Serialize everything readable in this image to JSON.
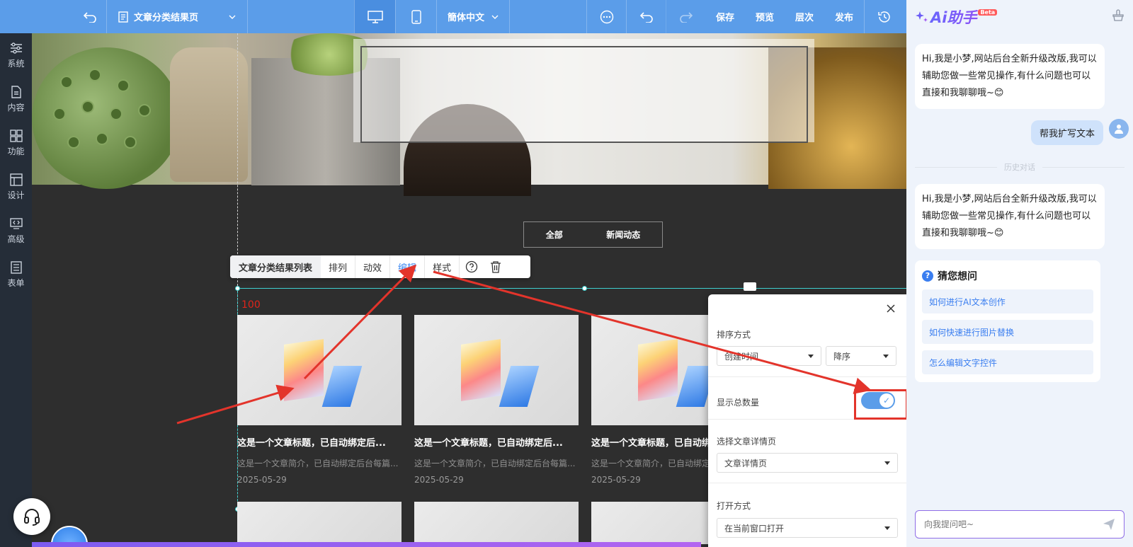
{
  "toolbar": {
    "page_name": "文章分类结果页",
    "language": "簡体中文",
    "save": "保存",
    "preview": "预览",
    "layers": "层次",
    "publish": "发布"
  },
  "sidebar": {
    "items": [
      {
        "label": "系统",
        "icon": "sliders-icon"
      },
      {
        "label": "内容",
        "icon": "document-icon"
      },
      {
        "label": "功能",
        "icon": "grid-icon"
      },
      {
        "label": "设计",
        "icon": "layout-icon"
      },
      {
        "label": "高级",
        "icon": "code-icon"
      },
      {
        "label": "表单",
        "icon": "form-icon"
      }
    ]
  },
  "canvas": {
    "category_tabs": [
      "全部",
      "新闻动态"
    ],
    "context_toolbar": {
      "title": "文章分类结果列表",
      "items": [
        "排列",
        "动效",
        "编辑",
        "样式"
      ]
    },
    "total_count": "100",
    "cards": [
      {
        "title": "这是一个文章标题，已自动绑定后...",
        "desc": "这是一个文章简介，已自动绑定后台每篇...",
        "date": "2025-05-29"
      },
      {
        "title": "这是一个文章标题，已自动绑定后...",
        "desc": "这是一个文章简介，已自动绑定后台每篇...",
        "date": "2025-05-29"
      },
      {
        "title": "这是一个文章标题，已自动绑定后...",
        "desc": "这是一个文章简介，已自动绑定后台每篇...",
        "date": "2025-05-29"
      }
    ]
  },
  "panel": {
    "sort_label": "排序方式",
    "sort_field": "创建时间",
    "sort_order": "降序",
    "show_total_label": "显示总数量",
    "show_total_on": true,
    "detail_label": "选择文章详情页",
    "detail_value": "文章详情页",
    "open_label": "打开方式",
    "open_value": "在当前窗口打开"
  },
  "ai": {
    "brand": "Ai助手",
    "beta": "Beta",
    "greeting": "Hi,我是小梦,网站后台全新升级改版,我可以辅助您做一些常见操作,有什么问题也可以直接和我聊聊哦~😊",
    "user_msg": "帮我扩写文本",
    "history_label": "历史对话",
    "greeting2": "Hi,我是小梦,网站后台全新升级改版,我可以辅助您做一些常见操作,有什么问题也可以直接和我聊聊哦~😊",
    "guess_title": "猜您想问",
    "guess_items": [
      "如何进行AI文本创作",
      "如何快速进行图片替换",
      "怎么编辑文字控件"
    ],
    "input_placeholder": "向我提问吧~"
  }
}
